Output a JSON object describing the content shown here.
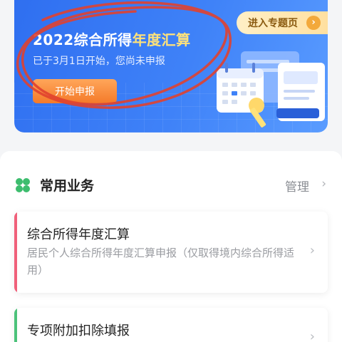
{
  "banner": {
    "title_prefix": "2022综合所得",
    "title_highlight": "年度汇算",
    "subtitle": "已于3月1日开始，您尚未申报",
    "start_button": "开始申报",
    "topic_link": "进入专题页",
    "topic_arrow": "›"
  },
  "section": {
    "title": "常用业务",
    "manage": "管理",
    "manage_chevron": "›"
  },
  "services": [
    {
      "title": "综合所得年度汇算",
      "desc": "居民个人综合所得年度汇算申报（仅取得境内综合所得适用）",
      "chevron": "›",
      "accent": "#f0607a"
    },
    {
      "title": "专项附加扣除填报",
      "chevron": "›",
      "accent": "#4cc27a"
    }
  ],
  "colors": {
    "banner_blue": "#3f82f8",
    "highlight_yellow": "#ffe27a",
    "button_orange": "#f47a2a",
    "scribble_red": "#e0412f",
    "clover_green": "#3dbd6e"
  }
}
